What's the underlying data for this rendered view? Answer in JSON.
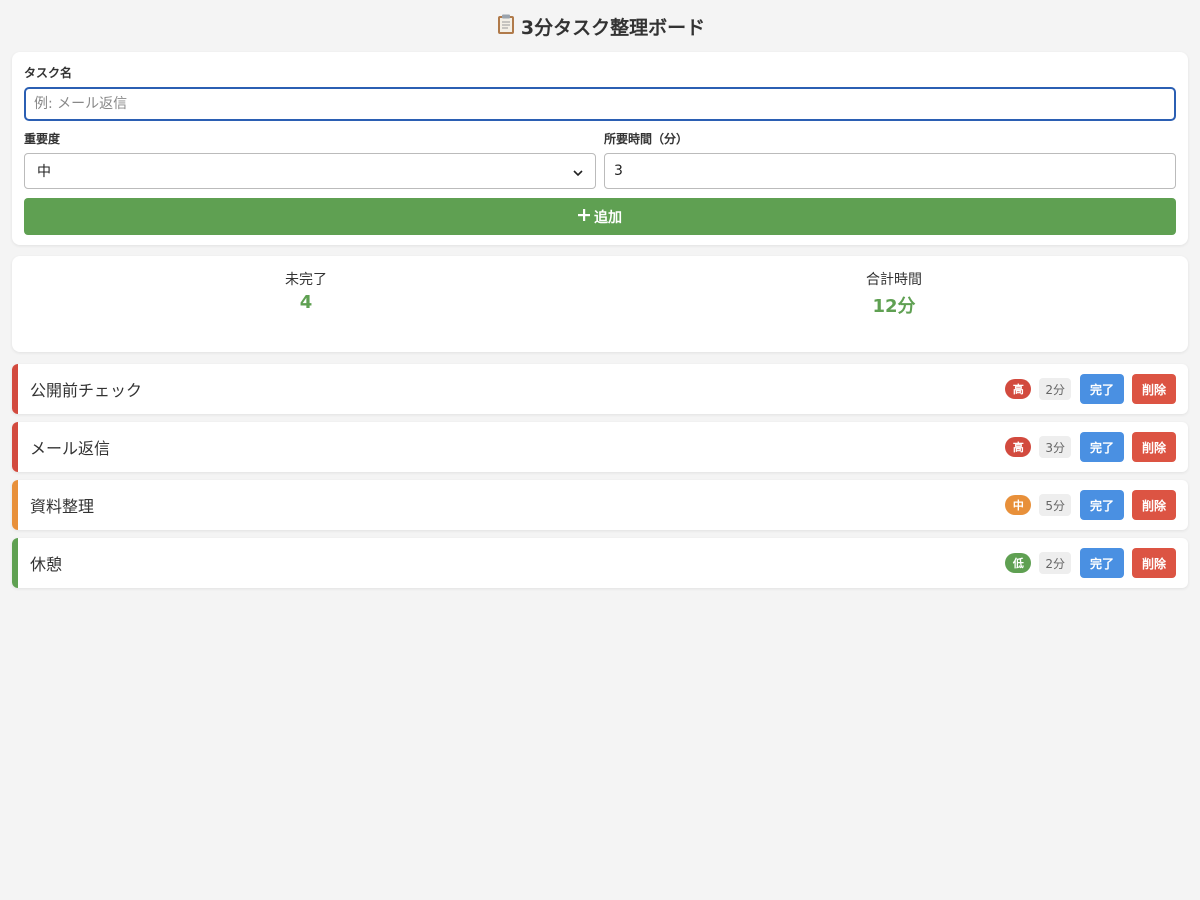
{
  "header": {
    "title": "3分タスク整理ボード",
    "icon": "clipboard-icon"
  },
  "form": {
    "task_name_label": "タスク名",
    "task_name_placeholder": "例: メール返信",
    "task_name_value": "",
    "priority_label": "重要度",
    "priority_value": "中",
    "duration_label": "所要時間（分）",
    "duration_value": "3",
    "add_button_label": "追加",
    "add_button_icon": "plus-icon"
  },
  "stats": {
    "pending_label": "未完了",
    "pending_value": "4",
    "total_time_label": "合計時間",
    "total_time_value": "12分"
  },
  "priority_colors": {
    "高": "#d24a3e",
    "中": "#e8903a",
    "低": "#5fa052"
  },
  "tasks": [
    {
      "name": "公開前チェック",
      "priority": "高",
      "duration": "2分",
      "done_label": "完了",
      "delete_label": "削除"
    },
    {
      "name": "メール返信",
      "priority": "高",
      "duration": "3分",
      "done_label": "完了",
      "delete_label": "削除"
    },
    {
      "name": "資料整理",
      "priority": "中",
      "duration": "5分",
      "done_label": "完了",
      "delete_label": "削除"
    },
    {
      "name": "休憩",
      "priority": "低",
      "duration": "2分",
      "done_label": "完了",
      "delete_label": "削除"
    }
  ]
}
